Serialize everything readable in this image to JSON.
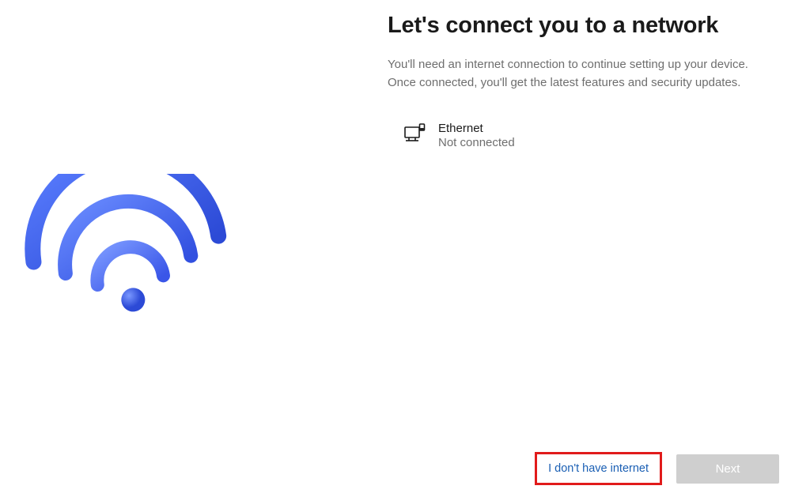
{
  "heading": "Let's connect you to a network",
  "description": "You'll need an internet connection to continue setting up your device. Once connected, you'll get the latest features and security updates.",
  "networks": [
    {
      "name": "Ethernet",
      "status": "Not connected",
      "icon": "ethernet-icon"
    }
  ],
  "buttons": {
    "no_internet_label": "I don't have internet",
    "next_label": "Next"
  },
  "colors": {
    "accent_blue": "#3b5bdb",
    "highlight_red": "#e11b1b"
  }
}
